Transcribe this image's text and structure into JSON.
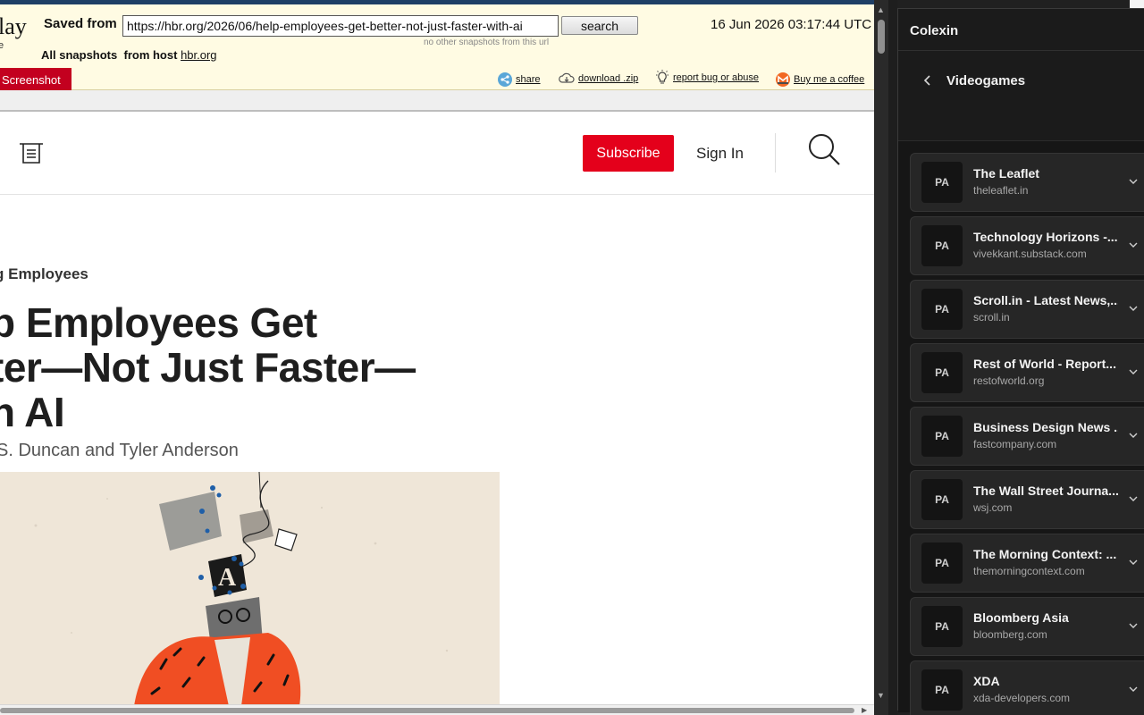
{
  "archive": {
    "logo_fragment": "lay",
    "logo_sub": "e",
    "saved_from_label": "Saved from",
    "url": "https://hbr.org/2026/06/help-employees-get-better-not-just-faster-with-ai",
    "search_label": "search",
    "no_other": "no other snapshots from this url",
    "timestamp": "16 Jun 2026 03:17:44 UTC",
    "all_snapshots_label": "All snapshots",
    "from_host_label": "from host",
    "host": "hbr.org",
    "screenshot_tab": "Screenshot",
    "share": "share",
    "download": "download .zip",
    "report": "report bug or abuse",
    "coffee": "Buy me a coffee"
  },
  "site": {
    "subscribe": "Subscribe",
    "sign_in": "Sign In",
    "topic": "g Employees",
    "headline": [
      "p Employees Get",
      "ter—Not Just Faster—",
      "h AI"
    ],
    "byline": "S. Duncan and Tyler Anderson"
  },
  "panel": {
    "app_name": "Colexin",
    "section": "Videogames",
    "feeds": [
      {
        "avatar": "PA",
        "name": "The Leaflet",
        "domain": "theleaflet.in"
      },
      {
        "avatar": "PA",
        "name": "Technology Horizons -...",
        "domain": "vivekkant.substack.com"
      },
      {
        "avatar": "PA",
        "name": "Scroll.in - Latest News,...",
        "domain": "scroll.in"
      },
      {
        "avatar": "PA",
        "name": "Rest of World - Report...",
        "domain": "restofworld.org"
      },
      {
        "avatar": "PA",
        "name": "Business Design News ...",
        "domain": "fastcompany.com"
      },
      {
        "avatar": "PA",
        "name": "The Wall Street Journa...",
        "domain": "wsj.com"
      },
      {
        "avatar": "PA",
        "name": "The Morning Context: ...",
        "domain": "themorningcontext.com"
      },
      {
        "avatar": "PA",
        "name": "Bloomberg Asia",
        "domain": "bloomberg.com"
      },
      {
        "avatar": "PA",
        "name": "XDA",
        "domain": "xda-developers.com"
      }
    ]
  },
  "colors": {
    "brand_red": "#e4001b",
    "archive_bg": "#fffbe3",
    "archive_tab": "#c3001f",
    "panel_bg": "#1b1b1b",
    "card_bg": "#262626"
  }
}
